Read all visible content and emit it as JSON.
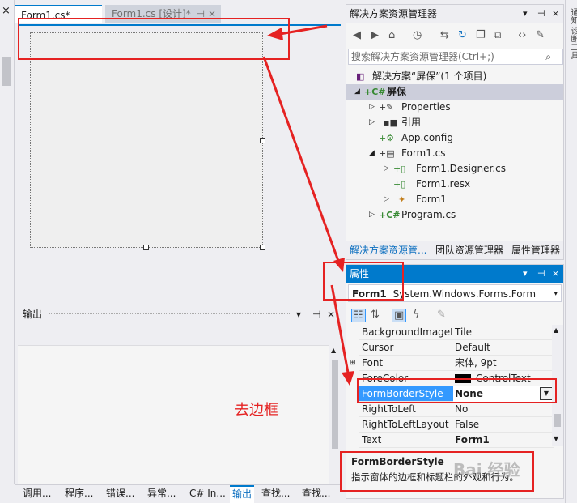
{
  "editor": {
    "tab_form1_cs": "Form1.cs*",
    "tab_form1_design": "Form1.cs [设计]*",
    "tab_close_glyph": "⊣ ×"
  },
  "output": {
    "title": "输出",
    "annotation": "去边框"
  },
  "bottom_tabs": [
    "调用...",
    "程序...",
    "错误...",
    "异常...",
    "C# In...",
    "输出",
    "查找...",
    "查找..."
  ],
  "solution_explorer": {
    "title": "解决方案资源管理器",
    "search_placeholder": "搜索解决方案资源管理器(Ctrl+;)",
    "tree": [
      {
        "label": "解决方案“屏保”(1 个项目)",
        "icon": "solution-icon"
      },
      {
        "label": "屏保",
        "icon": "csharp-project-icon"
      },
      {
        "label": "Properties",
        "icon": "wrench-icon"
      },
      {
        "label": "引用",
        "icon": "references-icon"
      },
      {
        "label": "App.config",
        "icon": "config-file-icon"
      },
      {
        "label": "Form1.cs",
        "icon": "form-icon"
      },
      {
        "label": "Form1.Designer.cs",
        "icon": "cs-file-icon"
      },
      {
        "label": "Form1.resx",
        "icon": "resx-file-icon"
      },
      {
        "label": "Form1",
        "icon": "class-icon"
      },
      {
        "label": "Program.cs",
        "icon": "csharp-file-icon"
      }
    ],
    "tabs": [
      "解决方案资源管...",
      "团队资源管理器",
      "属性管理器"
    ]
  },
  "properties": {
    "title": "属性",
    "object_name": "Form1",
    "object_type": "System.Windows.Forms.Form",
    "rows": [
      {
        "name": "BackgroundImageL",
        "value": "Tile"
      },
      {
        "name": "Cursor",
        "value": "Default"
      },
      {
        "name": "Font",
        "value": "宋体, 9pt"
      },
      {
        "name": "ForeColor",
        "value": "ControlText"
      },
      {
        "name": "FormBorderStyle",
        "value": "None"
      },
      {
        "name": "RightToLeft",
        "value": "No"
      },
      {
        "name": "RightToLeftLayout",
        "value": "False"
      },
      {
        "name": "Text",
        "value": "Form1"
      }
    ],
    "desc_title": "FormBorderStyle",
    "desc_text": "指示窗体的边框和标题栏的外观和行为。"
  },
  "right_strip": "通知 诊断工具",
  "watermark": "Bai 经验",
  "colors": {
    "accent": "#007acc",
    "annotation_red": "#e52222",
    "selection": "#3399ff"
  }
}
